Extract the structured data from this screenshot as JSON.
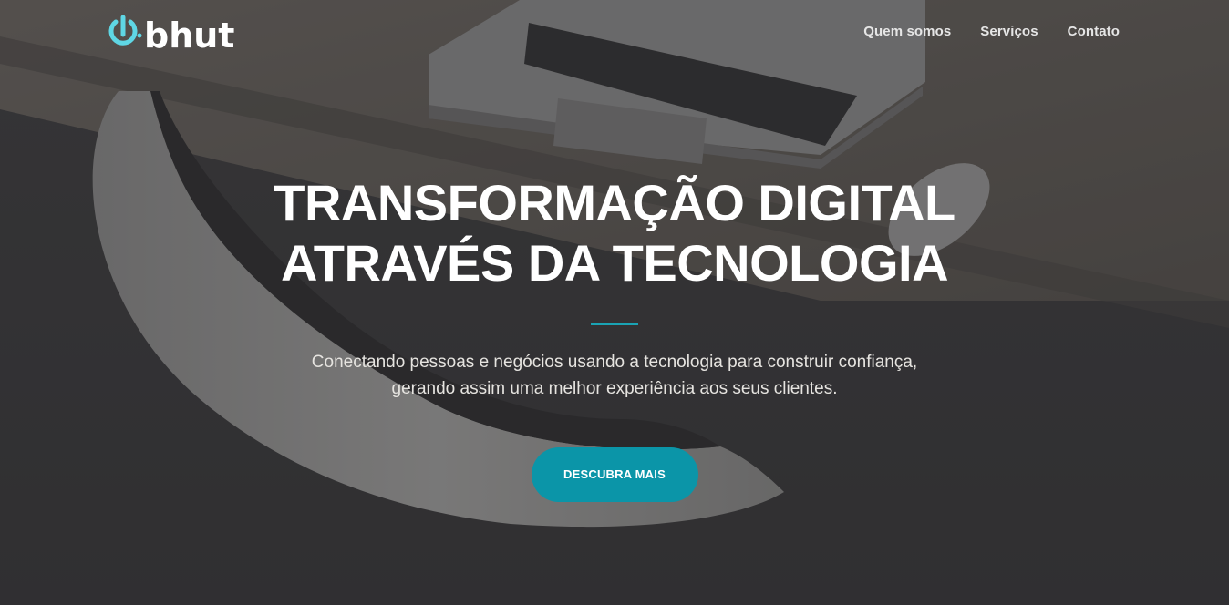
{
  "brand": {
    "logo_text": "bhut",
    "accent_color": "#5fd6e4"
  },
  "nav": {
    "items": [
      {
        "label": "Quem somos"
      },
      {
        "label": "Serviços"
      },
      {
        "label": "Contato"
      }
    ]
  },
  "hero": {
    "headline_line1": "TRANSFORMAÇÃO DIGITAL",
    "headline_line2": "ATRAVÉS DA TECNOLOGIA",
    "subtitle_line1": "Conectando pessoas e negócios usando a tecnologia para construir confiança,",
    "subtitle_line2": "gerando assim uma melhor experiência aos seus clientes.",
    "cta_label": "DESCUBRA MAIS",
    "cta_color": "#0b95a8",
    "divider_color": "#1aa3b4"
  }
}
